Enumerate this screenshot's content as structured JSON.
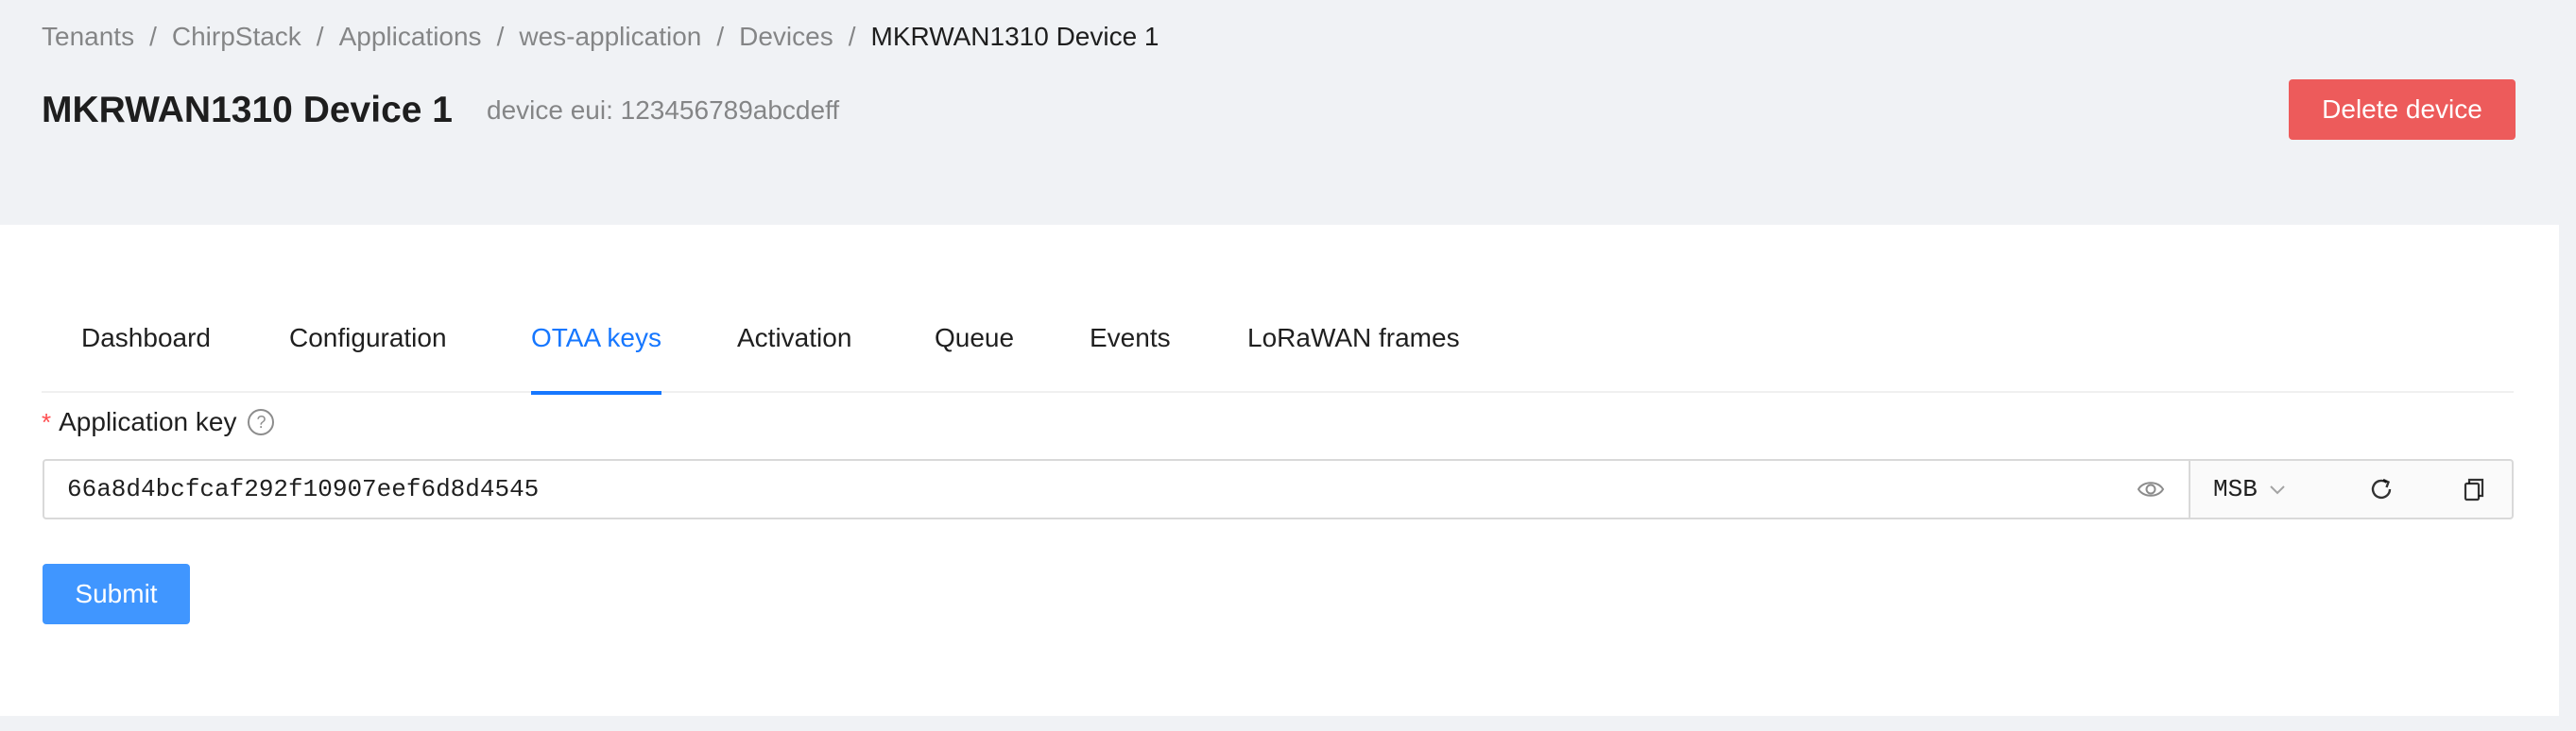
{
  "breadcrumb": {
    "items": [
      "Tenants",
      "ChirpStack",
      "Applications",
      "wes-application",
      "Devices"
    ],
    "current": "MKRWAN1310 Device 1",
    "separator": "/"
  },
  "header": {
    "title": "MKRWAN1310 Device 1",
    "subtitle": "device eui: 123456789abcdeff",
    "delete_label": "Delete device"
  },
  "tabs": [
    {
      "label": "Dashboard",
      "active": false
    },
    {
      "label": "Configuration",
      "active": false
    },
    {
      "label": "OTAA keys",
      "active": true
    },
    {
      "label": "Activation",
      "active": false
    },
    {
      "label": "Queue",
      "active": false
    },
    {
      "label": "Events",
      "active": false
    },
    {
      "label": "LoRaWAN frames",
      "active": false
    }
  ],
  "form": {
    "required_mark": "*",
    "app_key_label": "Application key",
    "help_glyph": "?",
    "app_key_value": "66a8d4bcfcaf292f10907eef6d8d4545",
    "byte_order": "MSB",
    "submit_label": "Submit"
  },
  "icons": {
    "visibility": "eye-icon",
    "byte_order_dropdown": "chevron-down-icon",
    "regenerate": "refresh-icon",
    "copy": "copy-icon",
    "help": "question-circle-icon"
  },
  "colors": {
    "primary": "#1677ff",
    "submit": "#4096ff",
    "danger": "#ed5b5b",
    "page_bg": "#f0f2f5"
  }
}
